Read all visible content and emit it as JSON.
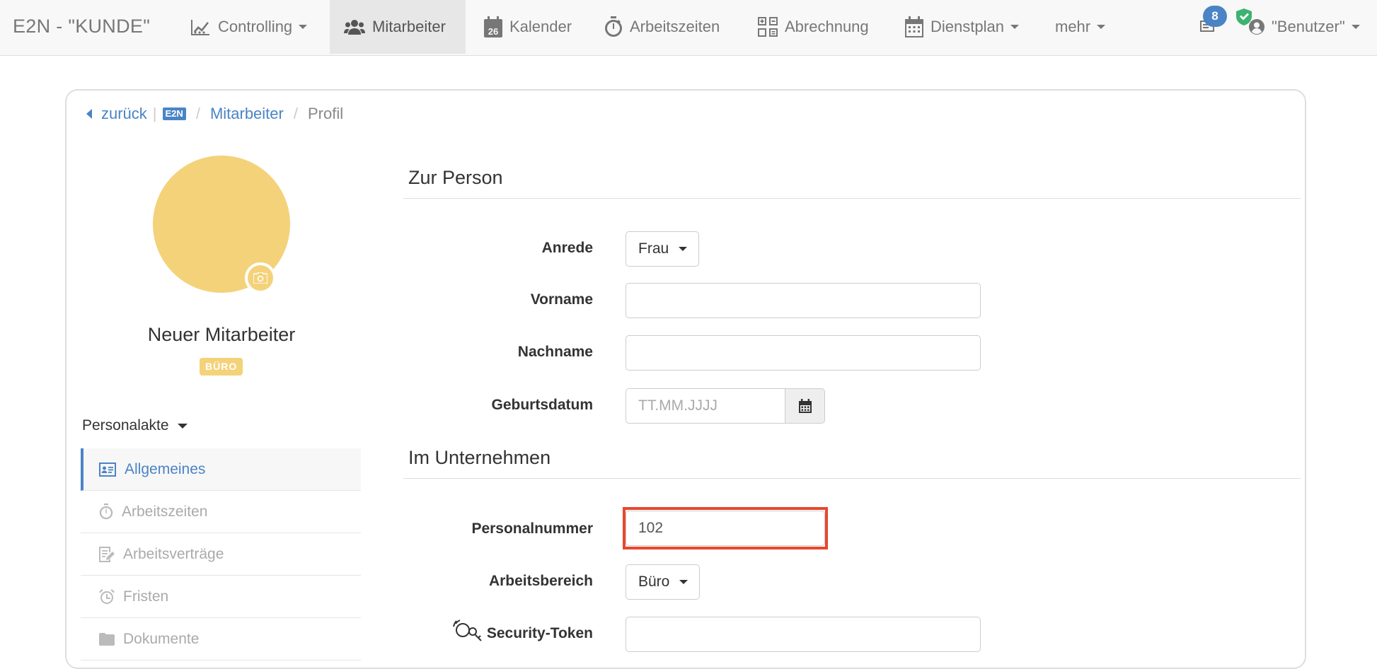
{
  "navbar": {
    "brand": "E2N - \"KUNDE\"",
    "items": [
      {
        "label": "Controlling",
        "icon": "chart-line-icon"
      },
      {
        "label": "Mitarbeiter",
        "icon": "users-icon"
      },
      {
        "label": "Kalender",
        "icon": "calendar-icon",
        "day": "26"
      },
      {
        "label": "Arbeitszeiten",
        "icon": "stopwatch-icon"
      },
      {
        "label": "Abrechnung",
        "icon": "calculator-icon"
      },
      {
        "label": "Dienstplan",
        "icon": "schedule-icon"
      },
      {
        "label": "mehr"
      }
    ],
    "notification_count": "8",
    "user_label": "\"Benutzer\""
  },
  "breadcrumb": {
    "back": "zurück",
    "divider": "|",
    "logo_text": "E2N",
    "section": "Mitarbeiter",
    "current": "Profil"
  },
  "profile": {
    "name": "Neuer Mitarbeiter",
    "department_badge": "BÜRO",
    "avatar_color": "#f4d27a"
  },
  "sidebar": {
    "group_label": "Personalakte",
    "items": [
      {
        "label": "Allgemeines",
        "icon": "id-card-icon",
        "active": true
      },
      {
        "label": "Arbeitszeiten",
        "icon": "stopwatch-icon"
      },
      {
        "label": "Arbeitsverträge",
        "icon": "contract-icon"
      },
      {
        "label": "Fristen",
        "icon": "alarm-clock-icon"
      },
      {
        "label": "Dokumente",
        "icon": "folder-icon"
      }
    ]
  },
  "form": {
    "section_person": "Zur Person",
    "anrede": {
      "label": "Anrede",
      "value": "Frau"
    },
    "vorname": {
      "label": "Vorname",
      "value": ""
    },
    "nachname": {
      "label": "Nachname",
      "value": ""
    },
    "geburtsdatum": {
      "label": "Geburtsdatum",
      "placeholder": "TT.MM.JJJJ"
    },
    "section_company": "Im Unternehmen",
    "personalnummer": {
      "label": "Personalnummer",
      "value": "102"
    },
    "arbeitsbereich": {
      "label": "Arbeitsbereich",
      "value": "Büro"
    },
    "security_token": {
      "label": "Security-Token",
      "value": ""
    }
  },
  "colors": {
    "accent": "#4a84c5",
    "highlight": "#e8472e",
    "shield": "#3cb371"
  }
}
